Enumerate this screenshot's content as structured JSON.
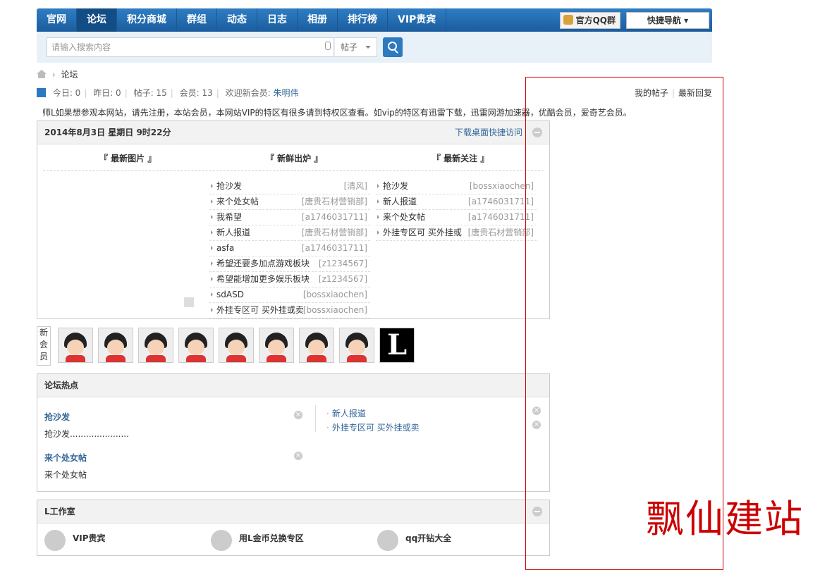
{
  "nav": {
    "items": [
      "官网",
      "论坛",
      "积分商城",
      "群组",
      "动态",
      "日志",
      "相册",
      "排行榜",
      "VIP贵宾"
    ],
    "qq_label": "官方QQ群",
    "quick_nav": "快捷导航"
  },
  "search": {
    "placeholder": "请输入搜索内容",
    "type": "帖子"
  },
  "breadcrumb": {
    "current": "论坛"
  },
  "stats": {
    "today": "今日: 0",
    "yesterday": "昨日: 0",
    "posts": "帖子: 15",
    "members": "会员: 13",
    "welcome": "欢迎新会员: ",
    "new_member": "朱明伟",
    "my_posts": "我的帖子",
    "latest_reply": "最新回复"
  },
  "notice": "师L如果想参观本网站，请先注册，本站会员，本网站VIP的特区有很多请到特权区查看。如vip的特区有迅雷下载，迅雷网游加速器，优酷会员，爱奇艺会员。",
  "portal": {
    "date": "2014年8月3日 星期日 9时22分",
    "download": "下载桌面快捷访问",
    "col1": "『 最新图片 』",
    "col2": "『 新鲜出炉 』",
    "col3": "『 最新关注 』",
    "fresh": [
      {
        "title": "抢沙发",
        "author": "[清风]"
      },
      {
        "title": "来个处女帖",
        "author": "[唐贵石材营销部]"
      },
      {
        "title": "我希望",
        "author": "[a1746031711]"
      },
      {
        "title": "新人报道",
        "author": "[唐贵石材营销部]"
      },
      {
        "title": "asfa",
        "author": "[a1746031711]"
      },
      {
        "title": "希望还要多加点游戏板块",
        "author": "[z1234567]"
      },
      {
        "title": "希望能增加更多娱乐板块",
        "author": "[z1234567]"
      },
      {
        "title": "sdASD",
        "author": "[bossxiaochen]"
      },
      {
        "title": "外挂专区可 买外挂或卖",
        "author": "[bossxiaochen]"
      }
    ],
    "follow": [
      {
        "title": "抢沙发",
        "author": "[bossxiaochen]"
      },
      {
        "title": "新人报道",
        "author": "[a1746031711]"
      },
      {
        "title": "来个处女帖",
        "author": "[a1746031711]"
      },
      {
        "title": "外挂专区可 买外挂或",
        "author": "[唐贵石材营销部]"
      }
    ]
  },
  "members_label": "新会员",
  "hot": {
    "title": "论坛热点",
    "items": [
      {
        "title": "抢沙发",
        "summary": "抢沙发......................"
      },
      {
        "title": "来个处女帖",
        "summary": "来个处女帖"
      }
    ],
    "links": [
      "新人报道",
      "外挂专区可 买外挂或卖"
    ]
  },
  "studio": {
    "title": "L工作室",
    "channels": [
      "VIP贵宾",
      "用L金币兑换专区",
      "qq开钻大全"
    ]
  },
  "watermark": "飘仙建站",
  "colors": {
    "nav": "#1a5d9e",
    "link": "#336699",
    "annotation": "#cc0000"
  }
}
